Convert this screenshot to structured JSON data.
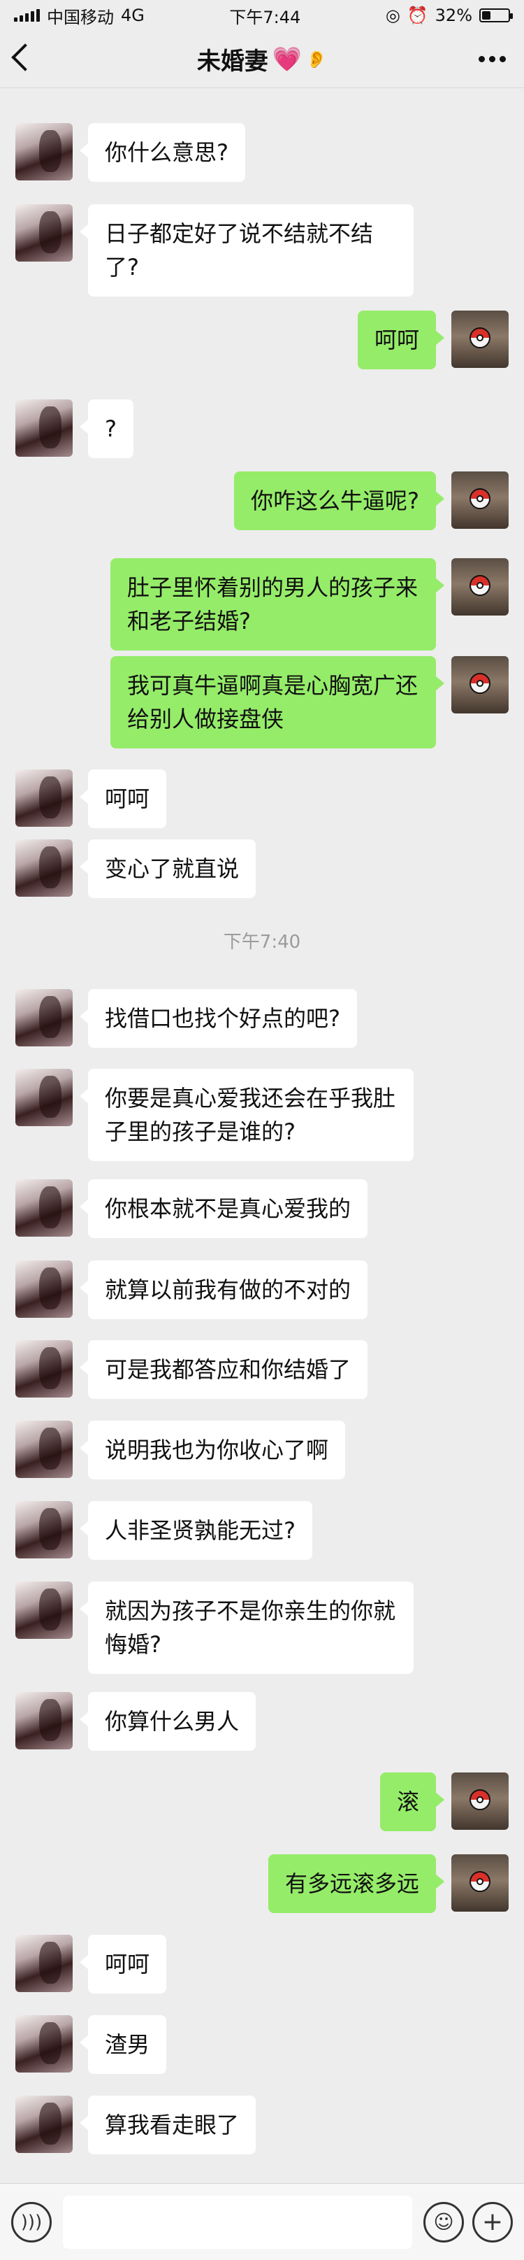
{
  "status_bar": {
    "carrier": "中国移动",
    "network": "4G",
    "time": "下午7:44",
    "battery_text": "32%",
    "battery_level": 0.32
  },
  "header": {
    "title": "未婚妻",
    "heart": "💗",
    "ear": "👂"
  },
  "messages": [
    {
      "side": "in",
      "text": "你什么意思?"
    },
    {
      "side": "in",
      "text": "日子都定好了说不结就不结了?"
    },
    {
      "side": "out",
      "text": "呵呵"
    },
    {
      "side": "in",
      "text": "?"
    },
    {
      "side": "out",
      "text": "你咋这么牛逼呢?"
    },
    {
      "side": "out",
      "text": "肚子里怀着别的男人的孩子来和老子结婚?"
    },
    {
      "side": "out",
      "text": "我可真牛逼啊真是心胸宽广还给别人做接盘侠"
    },
    {
      "side": "in",
      "text": "呵呵"
    },
    {
      "side": "in",
      "text": "变心了就直说"
    },
    {
      "side": "time",
      "text": "下午7:40"
    },
    {
      "side": "in",
      "text": "找借口也找个好点的吧?"
    },
    {
      "side": "in",
      "text": "你要是真心爱我还会在乎我肚子里的孩子是谁的?"
    },
    {
      "side": "in",
      "text": "你根本就不是真心爱我的"
    },
    {
      "side": "in",
      "text": "就算以前我有做的不对的"
    },
    {
      "side": "in",
      "text": "可是我都答应和你结婚了"
    },
    {
      "side": "in",
      "text": "说明我也为你收心了啊"
    },
    {
      "side": "in",
      "text": "人非圣贤孰能无过?"
    },
    {
      "side": "in",
      "text": "就因为孩子不是你亲生的你就悔婚?"
    },
    {
      "side": "in",
      "text": "你算什么男人"
    },
    {
      "side": "out",
      "text": "滚"
    },
    {
      "side": "out",
      "text": "有多远滚多远"
    },
    {
      "side": "in",
      "text": "呵呵"
    },
    {
      "side": "in",
      "text": "渣男"
    },
    {
      "side": "in",
      "text": "算我看走眼了"
    }
  ],
  "input_bar": {
    "voice_icon": "voice-icon",
    "emoji_icon": "emoji-icon",
    "plus_icon": "plus-icon"
  },
  "colors": {
    "background": "#ededed",
    "incoming_bubble": "#ffffff",
    "outgoing_bubble": "#95ec69",
    "heart": "#e84d9a"
  }
}
